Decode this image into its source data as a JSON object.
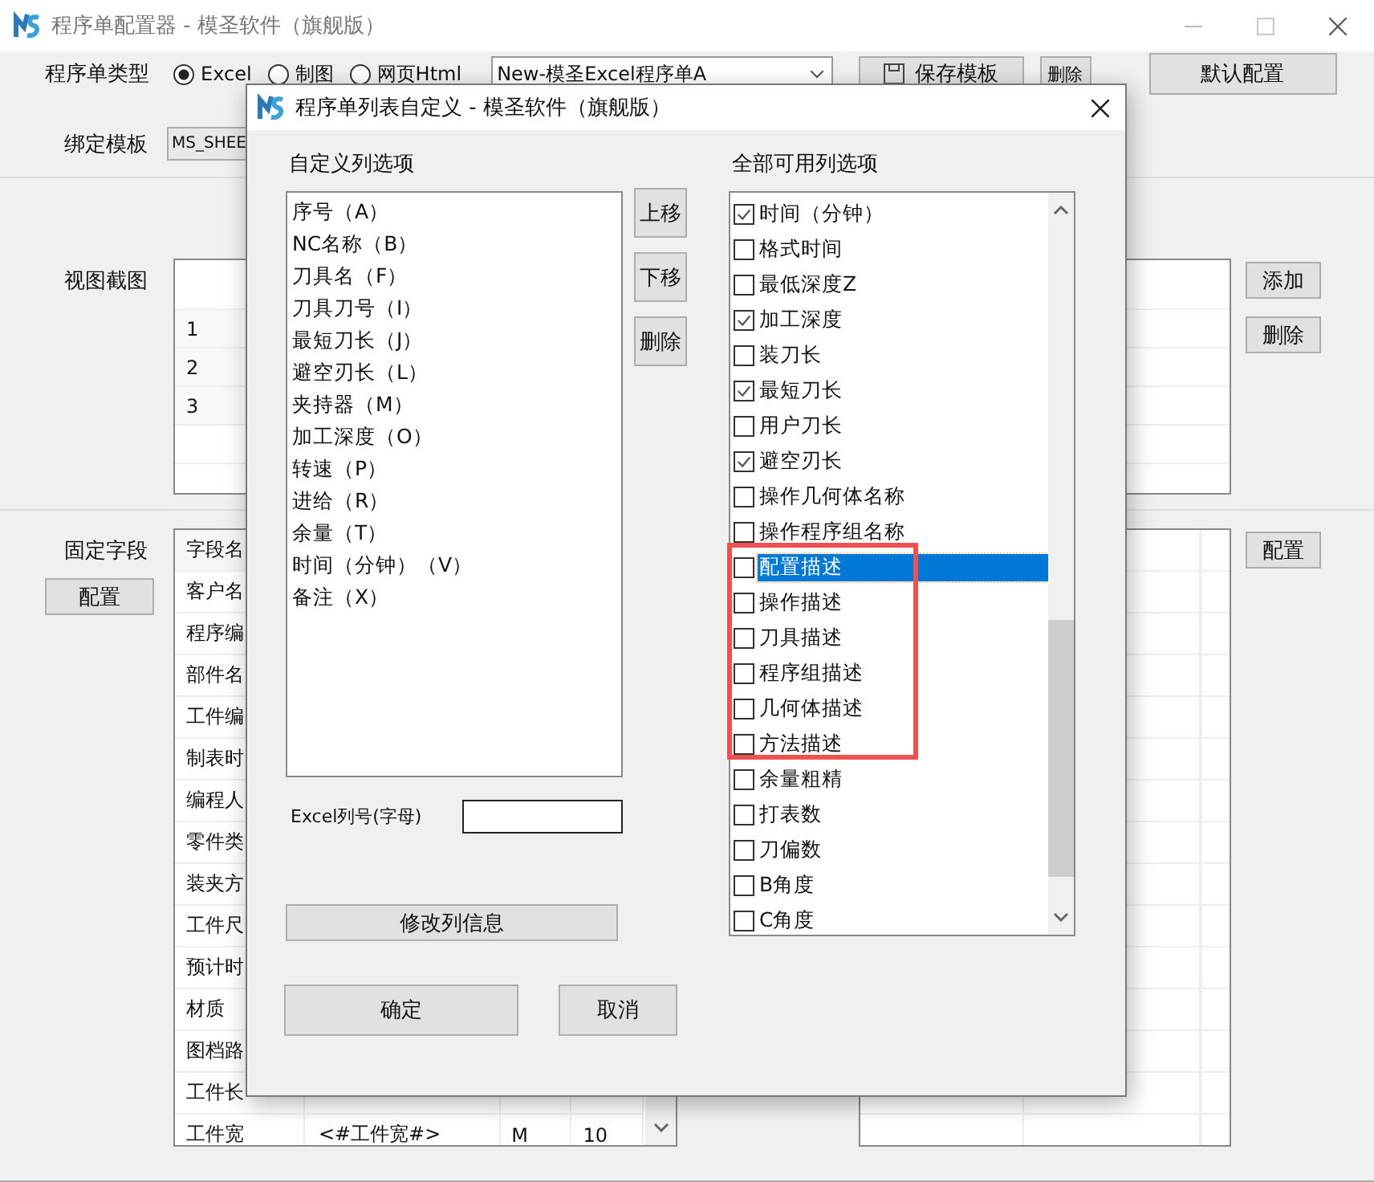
{
  "window": {
    "title": "程序单配置器 - 模圣软件（旗舰版）"
  },
  "type_row": {
    "label": "程序单类型",
    "options": [
      {
        "label": "Excel",
        "selected": true
      },
      {
        "label": "制图",
        "selected": false
      },
      {
        "label": "网页Html",
        "selected": false
      }
    ],
    "template_select": "New-模圣Excel程序单A",
    "save_button": "保存模板",
    "delete_button": "删除",
    "default_button": "默认配置"
  },
  "bind_row": {
    "label": "绑定模板",
    "value": "MS_SHEE"
  },
  "view_section": {
    "label": "视图截图",
    "rows": [
      "1",
      "2",
      "3"
    ],
    "add_button": "添加",
    "delete_button": "删除"
  },
  "fixed_section": {
    "label": "固定字段",
    "config_button": "配置",
    "side_button": "配置",
    "rows": [
      {
        "name": "字段名"
      },
      {
        "name": "客户名"
      },
      {
        "name": "程序编"
      },
      {
        "name": "部件名"
      },
      {
        "name": "工件编"
      },
      {
        "name": "制表时"
      },
      {
        "name": "编程人"
      },
      {
        "name": "零件类"
      },
      {
        "name": "装夹方"
      },
      {
        "name": "工件尺"
      },
      {
        "name": "预计时"
      },
      {
        "name": "材质"
      },
      {
        "name": "图档路"
      },
      {
        "name": "工件长"
      },
      {
        "name": "工件宽",
        "value": "<#工件宽#>",
        "column_3": "M",
        "column_4": "10"
      }
    ]
  },
  "dialog": {
    "title": "程序单列表自定义 - 模圣软件（旗舰版）",
    "custom_label": "自定义列选项",
    "custom_items": [
      {
        "label": "序号（A）",
        "selected": false
      },
      {
        "label": "NC名称（B）",
        "selected": false
      },
      {
        "label": "刀具名（F）",
        "selected": false
      },
      {
        "label": "刀具刀号（I）",
        "selected": false
      },
      {
        "label": "最短刀长（J）",
        "selected": false
      },
      {
        "label": "避空刃长（L）",
        "selected": false
      },
      {
        "label": "夹持器（M）",
        "selected": false
      },
      {
        "label": "加工深度（O）",
        "selected": false
      },
      {
        "label": "转速（P）",
        "selected": false
      },
      {
        "label": "进给（R）",
        "selected": false
      },
      {
        "label": "余量（T）",
        "selected": false
      },
      {
        "label": "时间（分钟）（V）",
        "selected": false
      },
      {
        "label": "备注（X）",
        "selected": false
      }
    ],
    "move_buttons": [
      "上移",
      "下移",
      "删除"
    ],
    "all_label": "全部可用列选项",
    "all_items": [
      {
        "label": "时间（分钟）",
        "checked": true,
        "selected": false
      },
      {
        "label": "格式时间",
        "checked": false,
        "selected": false
      },
      {
        "label": "最低深度Z",
        "checked": false,
        "selected": false
      },
      {
        "label": "加工深度",
        "checked": true,
        "selected": false
      },
      {
        "label": "装刀长",
        "checked": false,
        "selected": false
      },
      {
        "label": "最短刀长",
        "checked": true,
        "selected": false
      },
      {
        "label": "用户刀长",
        "checked": false,
        "selected": false
      },
      {
        "label": "避空刃长",
        "checked": true,
        "selected": false
      },
      {
        "label": "操作几何体名称",
        "checked": false,
        "selected": false
      },
      {
        "label": "操作程序组名称",
        "checked": false,
        "selected": false
      },
      {
        "label": "配置描述",
        "checked": false,
        "selected": true
      },
      {
        "label": "操作描述",
        "checked": false,
        "selected": false
      },
      {
        "label": "刀具描述",
        "checked": false,
        "selected": false
      },
      {
        "label": "程序组描述",
        "checked": false,
        "selected": false
      },
      {
        "label": "几何体描述",
        "checked": false,
        "selected": false
      },
      {
        "label": "方法描述",
        "checked": false,
        "selected": false
      },
      {
        "label": "余量粗精",
        "checked": false,
        "selected": false
      },
      {
        "label": "打表数",
        "checked": false,
        "selected": false
      },
      {
        "label": "刀偏数",
        "checked": false,
        "selected": false
      },
      {
        "label": "B角度",
        "checked": false,
        "selected": false
      },
      {
        "label": "C角度",
        "checked": false,
        "selected": false
      }
    ],
    "excel_label": "Excel列号(字母)",
    "modify_button": "修改列信息",
    "ok_button": "确定",
    "cancel_button": "取消"
  }
}
